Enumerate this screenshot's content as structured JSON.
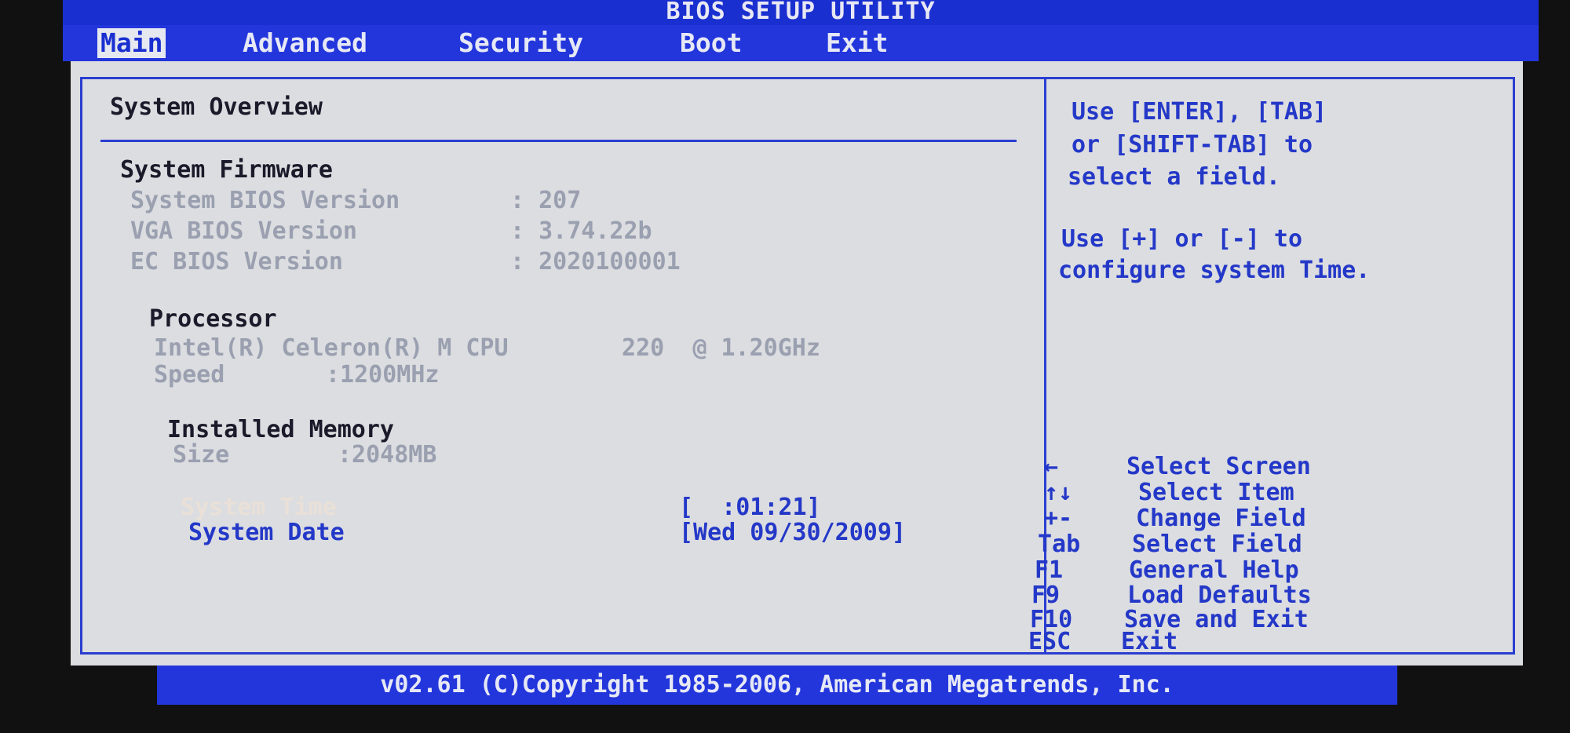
{
  "title": "BIOS SETUP UTILITY",
  "menu": [
    "Main",
    "Advanced",
    "Security",
    "Boot",
    "Exit"
  ],
  "active_menu": "Main",
  "main": {
    "section_title": "System Overview",
    "firmware": {
      "heading": "System Firmware",
      "rows": [
        {
          "label": "System BIOS Version",
          "value": ": 207"
        },
        {
          "label": "VGA BIOS Version",
          "value": ": 3.74.22b"
        },
        {
          "label": "EC BIOS Version",
          "value": ": 2020100001"
        }
      ]
    },
    "processor": {
      "heading": "Processor",
      "name": "Intel(R) Celeron(R) M CPU        220  @ 1.20GHz",
      "speed_label": "Speed",
      "speed_value": ":1200MHz"
    },
    "memory": {
      "heading": "Installed Memory",
      "size_label": "Size",
      "size_value": ":2048MB"
    },
    "system_time": {
      "label": "System Time",
      "value": "[  :01:21]"
    },
    "system_date": {
      "label": "System Date",
      "value": "[Wed 09/30/2009]"
    }
  },
  "help": {
    "lines1": [
      "Use [ENTER], [TAB]",
      "or [SHIFT-TAB] to",
      "select a field."
    ],
    "lines2": [
      "Use [+] or [-] to",
      "configure system Time."
    ],
    "keys": [
      {
        "key": "←",
        "desc": "Select Screen"
      },
      {
        "key": "↑↓",
        "desc": "Select Item"
      },
      {
        "key": "+-",
        "desc": "Change Field"
      },
      {
        "key": "Tab",
        "desc": "Select Field"
      },
      {
        "key": "F1",
        "desc": "General Help"
      },
      {
        "key": "F9",
        "desc": "Load Defaults"
      },
      {
        "key": "F10",
        "desc": "Save and Exit"
      },
      {
        "key": "ESC",
        "desc": "Exit"
      }
    ]
  },
  "footer": "v02.61 (C)Copyright 1985-2006, American Megatrends, Inc.",
  "colors": {
    "blue": "#2336dc",
    "panel": "#dcdde0",
    "text_gray": "#9aa0b0"
  }
}
